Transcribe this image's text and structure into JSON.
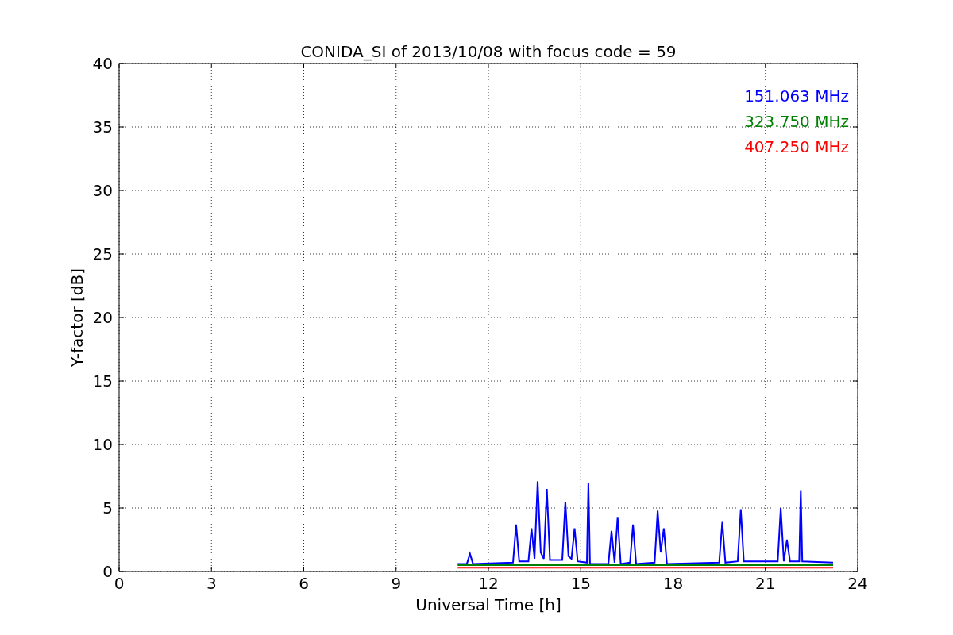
{
  "chart_data": {
    "type": "line",
    "title": "CONIDA_SI of 2013/10/08 with focus code = 59",
    "xlabel": "Universal Time [h]",
    "ylabel": "Y-factor [dB]",
    "x": [
      11.0,
      11.3,
      11.4,
      11.5,
      12.8,
      12.9,
      13.0,
      13.3,
      13.4,
      13.5,
      13.6,
      13.7,
      13.8,
      13.9,
      14.0,
      14.4,
      14.5,
      14.6,
      14.7,
      14.8,
      14.9,
      15.2,
      15.25,
      15.3,
      15.9,
      16.0,
      16.1,
      16.2,
      16.3,
      16.6,
      16.7,
      16.8,
      17.4,
      17.5,
      17.6,
      17.7,
      17.8,
      19.5,
      19.6,
      19.7,
      20.1,
      20.2,
      20.3,
      21.4,
      21.5,
      21.6,
      21.7,
      21.8,
      22.1,
      22.15,
      22.2,
      23.2
    ],
    "series": [
      {
        "name": "151.063 MHz",
        "color": "#0000ff",
        "values": [
          0.6,
          0.6,
          1.4,
          0.6,
          0.7,
          3.7,
          0.8,
          0.8,
          3.4,
          1.0,
          7.1,
          1.5,
          1.0,
          6.5,
          0.9,
          0.9,
          5.5,
          1.2,
          1.0,
          3.4,
          0.8,
          0.7,
          7.0,
          0.6,
          0.6,
          3.2,
          0.7,
          4.3,
          0.6,
          0.7,
          3.7,
          0.6,
          0.7,
          4.8,
          1.5,
          3.4,
          0.6,
          0.7,
          3.9,
          0.7,
          0.8,
          4.9,
          0.8,
          0.8,
          5.0,
          0.8,
          2.5,
          0.8,
          0.8,
          6.4,
          0.8,
          0.7
        ]
      },
      {
        "name": "323.750 MHz",
        "color": "#008000",
        "values": [
          0.5,
          0.5,
          0.5,
          0.5,
          0.5,
          0.5,
          0.5,
          0.5,
          0.5,
          0.5,
          0.5,
          0.5,
          0.5,
          0.5,
          0.5,
          0.5,
          0.5,
          0.5,
          0.5,
          0.5,
          0.5,
          0.5,
          0.5,
          0.5,
          0.5,
          0.5,
          0.5,
          0.5,
          0.5,
          0.5,
          0.5,
          0.5,
          0.5,
          0.5,
          0.5,
          0.5,
          0.5,
          0.5,
          0.5,
          0.5,
          0.5,
          0.5,
          0.5,
          0.5,
          0.5,
          0.5,
          0.5,
          0.5,
          0.5,
          0.5,
          0.5,
          0.5
        ]
      },
      {
        "name": "407.250 MHz",
        "color": "#ff0000",
        "values": [
          0.3,
          0.3,
          0.3,
          0.3,
          0.3,
          0.3,
          0.3,
          0.3,
          0.3,
          0.3,
          0.3,
          0.3,
          0.3,
          0.3,
          0.3,
          0.3,
          0.3,
          0.3,
          0.3,
          0.3,
          0.3,
          0.3,
          0.3,
          0.3,
          0.3,
          0.3,
          0.3,
          0.3,
          0.3,
          0.3,
          0.3,
          0.3,
          0.3,
          0.3,
          0.3,
          0.3,
          0.3,
          0.3,
          0.3,
          0.3,
          0.3,
          0.3,
          0.3,
          0.3,
          0.3,
          0.3,
          0.3,
          0.3,
          0.3,
          0.3,
          0.3,
          0.3
        ]
      }
    ],
    "xlim": [
      0,
      24
    ],
    "ylim": [
      0,
      40
    ],
    "xticks": [
      0,
      3,
      6,
      9,
      12,
      15,
      18,
      21,
      24
    ],
    "yticks": [
      0,
      5,
      10,
      15,
      20,
      25,
      30,
      35,
      40
    ],
    "grid": true
  }
}
